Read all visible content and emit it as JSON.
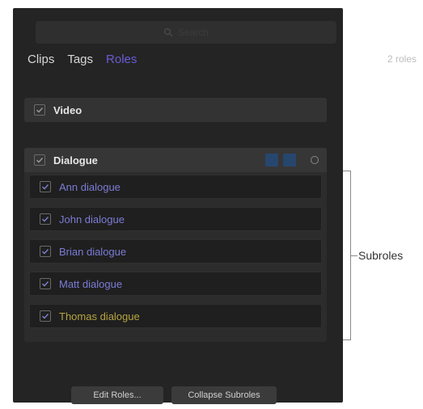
{
  "search": {
    "placeholder": "Search"
  },
  "tabs": [
    {
      "label": "Clips",
      "active": false
    },
    {
      "label": "Tags",
      "active": false
    },
    {
      "label": "Roles",
      "active": true
    }
  ],
  "count_label": "2 roles",
  "roles": [
    {
      "label": "Video"
    },
    {
      "label": "Dialogue"
    }
  ],
  "subroles": [
    {
      "label": "Ann dialogue"
    },
    {
      "label": "John dialogue"
    },
    {
      "label": "Brian dialogue"
    },
    {
      "label": "Matt dialogue"
    },
    {
      "label": "Thomas dialogue"
    }
  ],
  "annotation": {
    "subroles_label": "Subroles"
  },
  "footer": {
    "edit_button": "Edit Roles...",
    "collapse_button": "Collapse Subroles"
  },
  "colors": {
    "panel_bg": "#242424",
    "active_tab": "#6a5bd6",
    "subrole_text": "#7b7bd6",
    "subrole_text_last": "#b6a441"
  },
  "icons": [
    "search-icon",
    "checkbox-icon",
    "role-tool-icon",
    "focus-dot-icon"
  ]
}
